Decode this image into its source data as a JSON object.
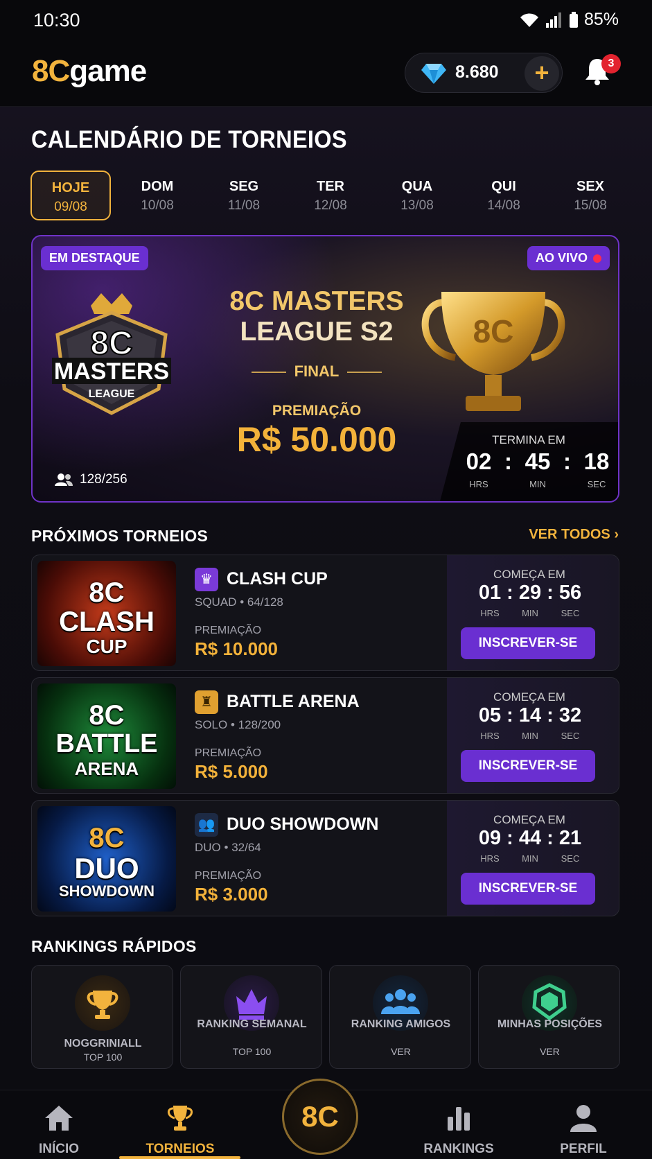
{
  "status": {
    "time": "10:30",
    "battery": "85%"
  },
  "header": {
    "logo_8c": "8C",
    "logo_game": "game",
    "diamonds": "8.680",
    "plus": "+",
    "notifications": "3"
  },
  "page_title": "CALENDÁRIO DE TORNEIOS",
  "days": [
    {
      "name": "HOJE",
      "date": "09/08",
      "active": true
    },
    {
      "name": "DOM",
      "date": "10/08"
    },
    {
      "name": "SEG",
      "date": "11/08"
    },
    {
      "name": "TER",
      "date": "12/08"
    },
    {
      "name": "QUA",
      "date": "13/08"
    },
    {
      "name": "QUI",
      "date": "14/08"
    },
    {
      "name": "SEX",
      "date": "15/08"
    }
  ],
  "featured": {
    "tag": "EM DESTAQUE",
    "live": "AO VIVO",
    "badge_8c": "8C",
    "badge_masters": "MASTERS",
    "badge_league": "LEAGUE",
    "title_line1": "8C MASTERS",
    "title_line2": "LEAGUE S2",
    "stage": "FINAL",
    "prize_label": "PREMIAÇÃO",
    "prize": "R$ 50.000",
    "trophy_text": "8C",
    "players": "128/256",
    "ends_label": "TERMINA EM",
    "timer": {
      "h": "02",
      "m": "45",
      "s": "18"
    },
    "units": {
      "h": "HRS",
      "m": "MIN",
      "s": "SEC"
    }
  },
  "upcoming": {
    "title": "PRÓXIMOS TORNEIOS",
    "see_all": "VER TODOS",
    "starts_label": "COMEÇA EM",
    "units": {
      "h": "HRS",
      "m": "MIN",
      "s": "SEC"
    },
    "prize_label": "PREMIAÇÃO",
    "button": "INSCREVER-SE",
    "items": [
      {
        "name": "CLASH CUP",
        "mode": "SQUAD",
        "slots": "64/128",
        "prize": "R$ 10.000",
        "thumb_1": "8C",
        "thumb_2": "CLASH",
        "thumb_3": "CUP",
        "timer": {
          "h": "01",
          "m": "29",
          "s": "56"
        }
      },
      {
        "name": "BATTLE ARENA",
        "mode": "SOLO",
        "slots": "128/200",
        "prize": "R$ 5.000",
        "thumb_1": "8C",
        "thumb_2": "BATTLE",
        "thumb_3": "ARENA",
        "timer": {
          "h": "05",
          "m": "14",
          "s": "32"
        }
      },
      {
        "name": "DUO SHOWDOWN",
        "mode": "DUO",
        "slots": "32/64",
        "prize": "R$ 3.000",
        "thumb_1": "8C",
        "thumb_2": "DUO",
        "thumb_3": "SHOWDOWN",
        "timer": {
          "h": "09",
          "m": "44",
          "s": "21"
        }
      }
    ]
  },
  "rankings": {
    "title": "RANKINGS RÁPIDOS",
    "items": [
      {
        "title": "NOGGRINIALL",
        "sub": "TOP 100",
        "icon": "trophy-icon",
        "color": "#f2b33d"
      },
      {
        "title": "RANKING SEMANAL",
        "sub": "TOP 100",
        "icon": "crown-icon",
        "color": "#8b4ef0"
      },
      {
        "title": "RANKING AMIGOS",
        "sub": "VER",
        "icon": "friends-icon",
        "color": "#4aa3f0"
      },
      {
        "title": "MINHAS POSIÇÕES",
        "sub": "VER",
        "icon": "badge-icon",
        "color": "#3fcf8e"
      }
    ]
  },
  "nav": {
    "home": "INÍCIO",
    "tournaments": "TORNEIOS",
    "center": "8C",
    "rankings": "RANKINGS",
    "profile": "PERFIL"
  },
  "colors": {
    "accent": "#f2b33d",
    "purple": "#6a2fd1",
    "live": "#ff2b4a"
  }
}
